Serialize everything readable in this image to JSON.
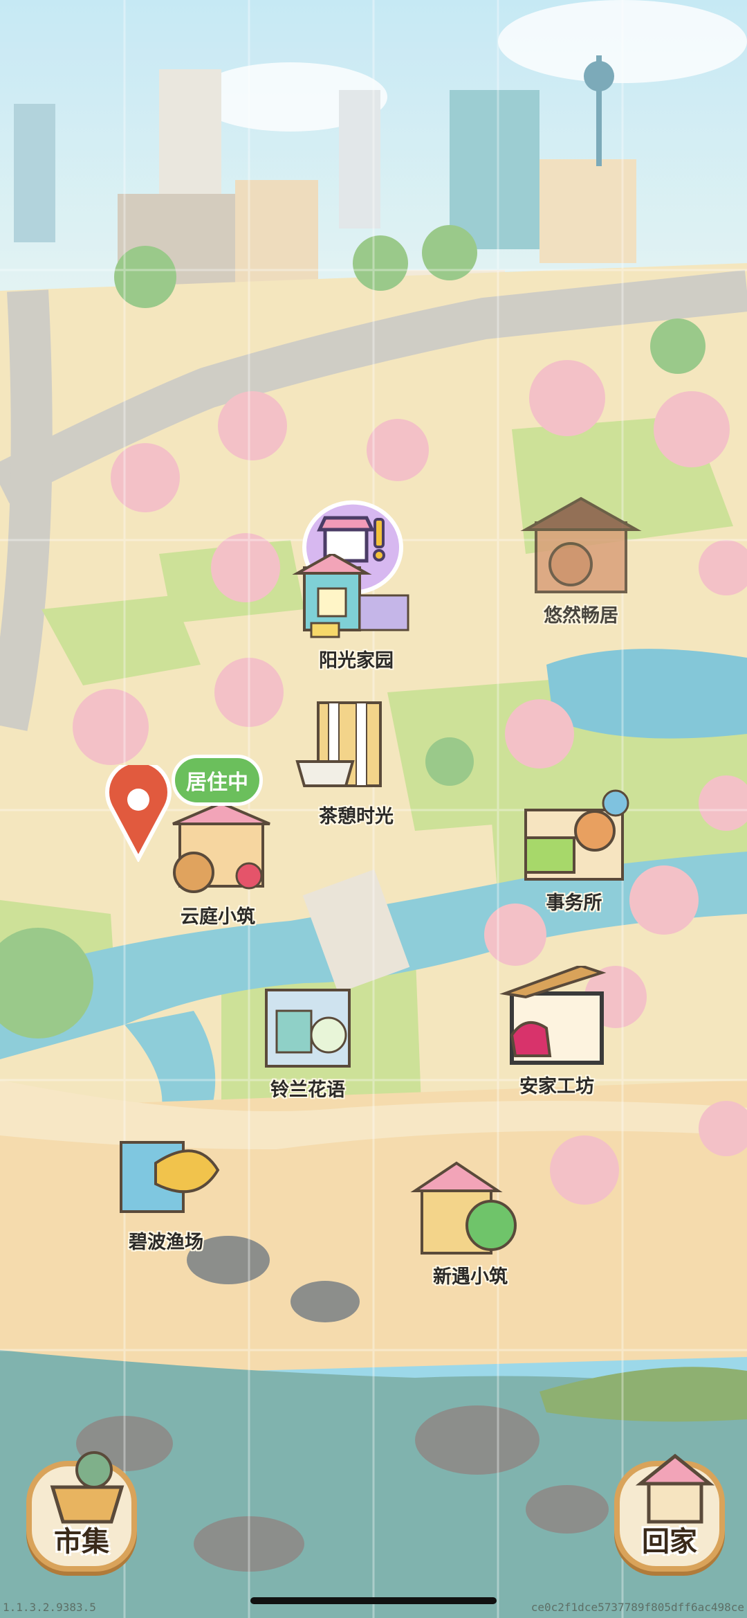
{
  "locations": [
    {
      "name": "阳光家园"
    },
    {
      "name": "悠然畅居"
    },
    {
      "name": "茶憩时光"
    },
    {
      "name": "云庭小筑"
    },
    {
      "name": "事务所"
    },
    {
      "name": "铃兰花语"
    },
    {
      "name": "安家工坊"
    },
    {
      "name": "碧波渔场"
    },
    {
      "name": "新遇小筑"
    }
  ],
  "status_badge": "居住中",
  "buttons": {
    "market": "市集",
    "home": "回家"
  },
  "footer": {
    "version": "1.1.3.2.9383.5",
    "build_id": "ce0c2f1dce5737789f805dff6ac498ce"
  }
}
